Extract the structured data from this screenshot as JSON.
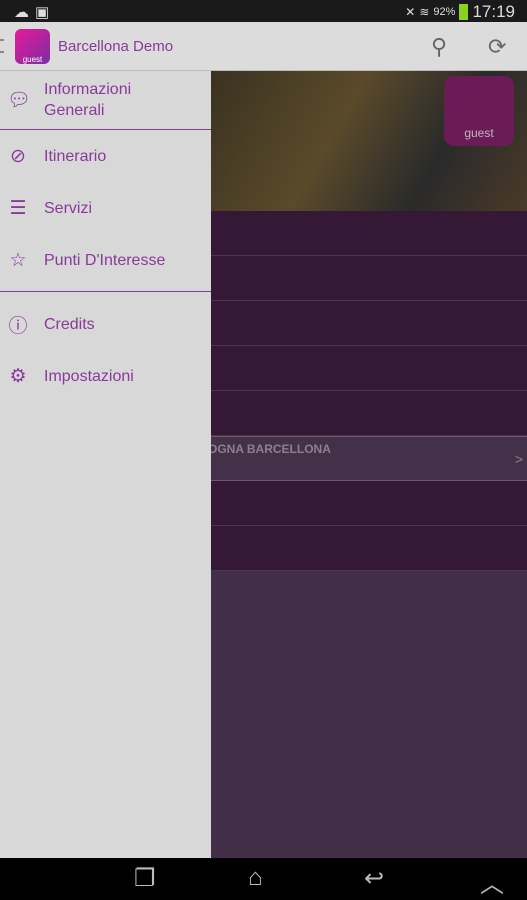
{
  "status_bar": {
    "battery": "92%",
    "time": "17:19"
  },
  "app_bar": {
    "title": "Barcellona Demo",
    "logo_text": "guest"
  },
  "drawer": {
    "items": [
      {
        "label": "Informazioni Generali",
        "icon": "chat-bubble-icon"
      },
      {
        "label": "Itinerario",
        "icon": "compass-icon"
      },
      {
        "label": "Servizi",
        "icon": "drawer-cabinet-icon"
      },
      {
        "label": "Punti D'Interesse",
        "icon": "star-icon"
      },
      {
        "label": "Credits",
        "icon": "info-icon"
      },
      {
        "label": "Impostazioni",
        "icon": "gear-icon"
      }
    ]
  },
  "content": {
    "highlight_row": "OGNA BARCELLONA",
    "chevron": ">",
    "hero_logo_text": "guest"
  },
  "colors": {
    "accent": "#8a3a9a",
    "list_bg": "#341836",
    "drawer_bg": "#d8d8d8"
  }
}
